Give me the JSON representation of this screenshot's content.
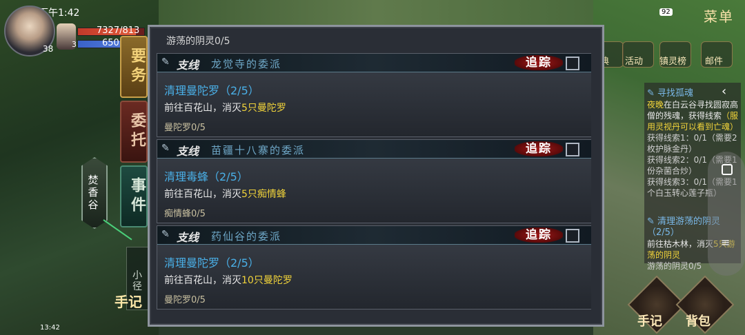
{
  "status_bar": {
    "time": "下午1:42",
    "battery": "92",
    "small_time": "13:42"
  },
  "player": {
    "level": "38",
    "hp": "7327/813",
    "mp": "650"
  },
  "companion": {
    "level": "37"
  },
  "tabs": [
    {
      "label": "要务"
    },
    {
      "label": "委托"
    },
    {
      "label": "事件"
    }
  ],
  "location": {
    "label": "焚香谷"
  },
  "path_label": "小径",
  "journal_label": "手记",
  "top_right": {
    "menu": "菜单",
    "items": [
      "典",
      "活动",
      "镇灵榜",
      "邮件"
    ]
  },
  "panel": {
    "top_progress": "游荡的阴灵0/5",
    "quests": [
      {
        "kind": "支线",
        "source": "龙觉寺的委派",
        "track": "追踪",
        "title": "清理曼陀罗（2/5）",
        "desc_prefix": "前往百花山，消灭",
        "desc_target": "5只曼陀罗",
        "progress": "曼陀罗0/5"
      },
      {
        "kind": "支线",
        "source": "苗疆十八寨的委派",
        "track": "追踪",
        "title": "清理毒蜂（2/5）",
        "desc_prefix": "前往百花山，消灭",
        "desc_target": "5只痴情蜂",
        "progress": "痴情蜂0/5"
      },
      {
        "kind": "支线",
        "source": "药仙谷的委派",
        "track": "追踪",
        "title": "清理曼陀罗（2/5）",
        "desc_prefix": "前往百花山，消灭",
        "desc_target": "10只曼陀罗",
        "progress": "曼陀罗0/5"
      }
    ]
  },
  "tracker": {
    "q1_title": "寻找孤魂",
    "q1_desc_a": "夜晚",
    "q1_desc_b": "在白云谷寻找圆寂高僧的残魂，获得线索",
    "q1_desc_c": "（服用灵视丹可以看到亡魂）",
    "clue1": "获得线索1：0/1（需要2枚护脉金丹）",
    "clue2": "获得线索2：0/1（需要1份杂菌合炒）",
    "clue3": "获得线索3：0/1（需要1个白玉转心莲子瓶）",
    "q2_title": "清理游荡的阴灵（2/5）",
    "q2_desc_a": "前往枯木林，消灭",
    "q2_desc_b": "5只游荡的阴灵",
    "q2_progress": "游荡的阴灵0/5"
  },
  "bottom_buttons": [
    "手记",
    "背包"
  ]
}
